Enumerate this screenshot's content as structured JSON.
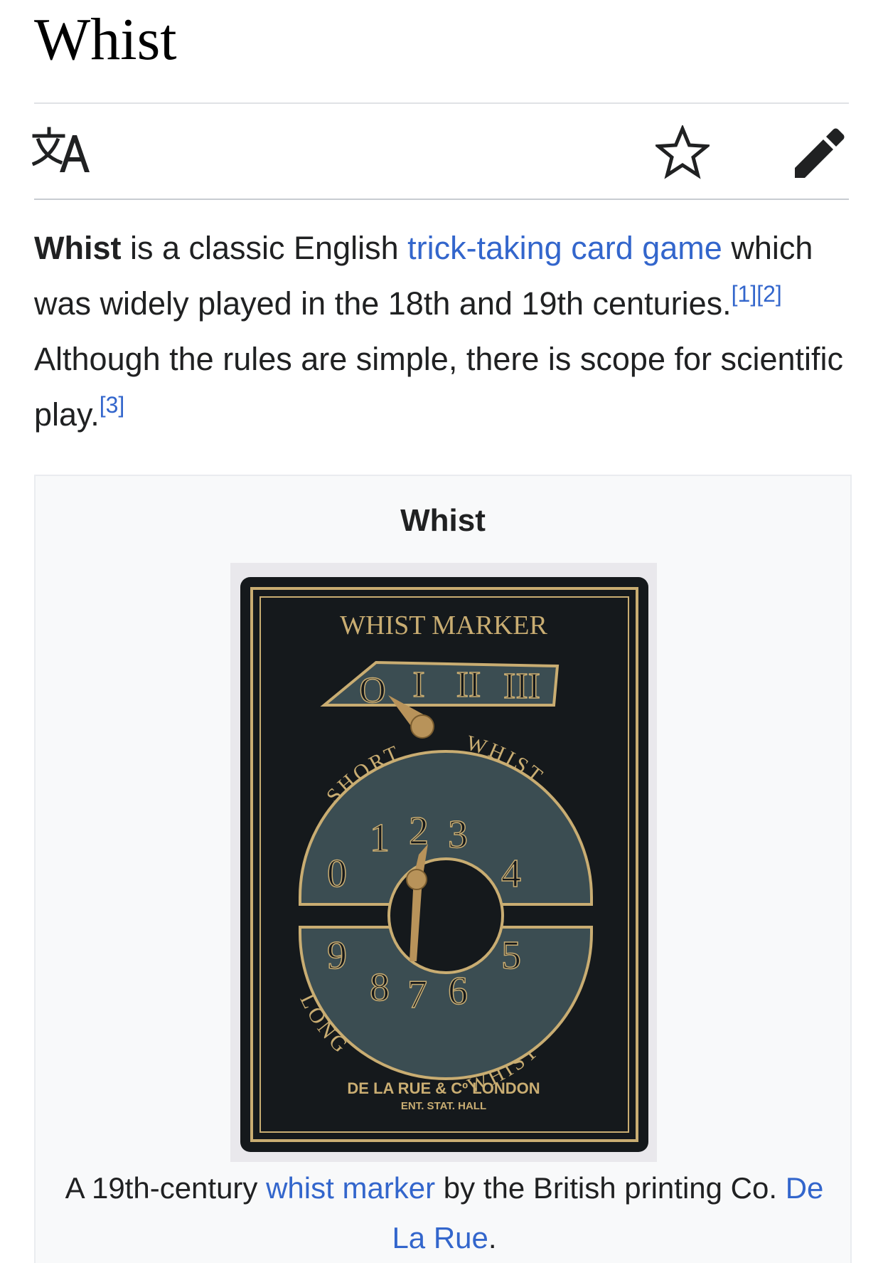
{
  "page": {
    "title": "Whist"
  },
  "toolbar": {
    "language_icon": "translate-icon",
    "watch_icon": "star-icon",
    "edit_icon": "pencil-icon"
  },
  "lead": {
    "bold_term": "Whist",
    "text_1": " is a classic English ",
    "link_1": "trick-taking card game",
    "text_2": " which was widely played in the 18th and 19th centuries.",
    "ref_1": "[1]",
    "ref_2": "[2]",
    "text_3": " Although the rules are simple, there is scope for scientific play.",
    "ref_3": "[3]"
  },
  "infobox": {
    "title": "Whist",
    "image": {
      "header": "WHIST MARKER",
      "upper_dial": [
        "O",
        "I",
        "II",
        "III"
      ],
      "arc_upper_left": "SHORT",
      "arc_upper_right": "WHIST.",
      "lower_dial_top": [
        "0",
        "1",
        "2",
        "3",
        "4"
      ],
      "lower_dial_bottom": [
        "9",
        "8",
        "7",
        "6",
        "5"
      ],
      "arc_lower_left": "LONG",
      "arc_lower_right": "WHIST",
      "maker": "DE LA RUE & Cº LONDON",
      "registration": "ENT. STAT. HALL"
    },
    "caption": {
      "text_1": "A 19th-century ",
      "link_1": "whist marker",
      "text_2": " by the British printing Co. ",
      "link_2": "De La Rue",
      "text_3": "."
    }
  },
  "colors": {
    "link": "#3366cc",
    "text": "#202122",
    "divider": "#c8ccd1",
    "infobox_bg": "#f8f9fa",
    "marker_leather": "#15191c",
    "marker_gold": "#c9ad72",
    "marker_slate": "#3b4d52"
  }
}
